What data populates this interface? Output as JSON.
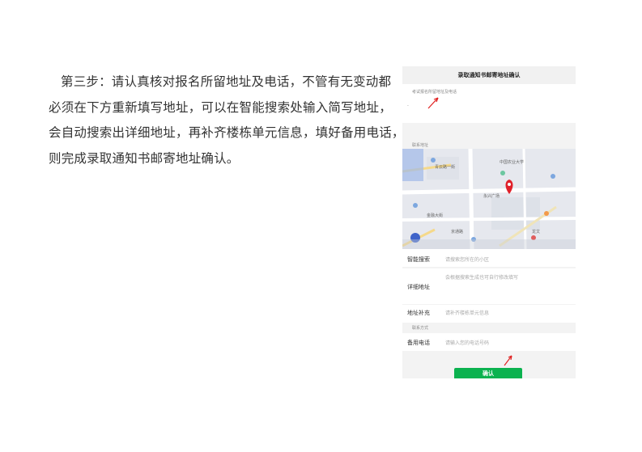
{
  "instructions": {
    "line1": "第三步：请认真核对报名所留地址及电话，不管有无变动都",
    "line2": "必须在下方重新填写地址，可以在智能搜索处输入简写地址，",
    "line3": "会自动搜索出详细地址，再补齐楼栋单元信息，填好备用电话，",
    "line4": "则完成录取通知书邮寄地址确认。"
  },
  "phone": {
    "title": "录取通知书邮寄地址确认",
    "registered_label": "考试报名所留地址及电话",
    "registered_value": "·",
    "contact_label": "联系地址",
    "map_labels": {
      "a": "青云路一街",
      "b": "永兴广场",
      "c": "中国农业大学",
      "d": "金融大街",
      "e": "龙文",
      "f": "京通路"
    },
    "fields": [
      {
        "label": "智能搜索",
        "placeholder": "请搜索您所在的小区"
      },
      {
        "label": "详细地址",
        "placeholder": "会根据搜索生成也可自行修改填写"
      },
      {
        "label": "地址补充",
        "placeholder": "请补齐楼栋单元信息"
      }
    ],
    "contact2_label": "联系方式",
    "phone_field": {
      "label": "备用电话",
      "placeholder": "请输入您的电话号码"
    },
    "confirm_label": "确认"
  },
  "colors": {
    "accent": "#0bb24f",
    "arrow": "#e02020",
    "marker": "#e0202a"
  }
}
